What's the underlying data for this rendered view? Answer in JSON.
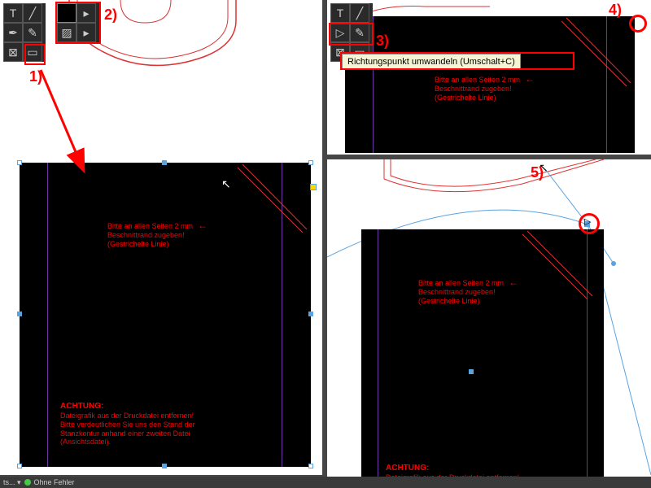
{
  "labels": {
    "l1": "1)",
    "l2": "2)",
    "l3": "3)",
    "l4": "4)",
    "l5": "5)"
  },
  "tooltip": {
    "text": "Richtungspunkt umwandeln (Umschalt+C)"
  },
  "hint": {
    "line1": "Bitte an allen Seiten 2 mm",
    "line2": "Beschnittrand zugeben!",
    "line3": "(Gestrichelte Linie)"
  },
  "warning": {
    "title": "ACHTUNG:",
    "line1": "Dateigrafik aus der Druckdatei entfernen!",
    "line2": "Bitte verdeutlichen Sie uns den Stand der",
    "line3": "Stanzkontur anhand einer zweiten Datei",
    "line4": "(Ansichtsdatei)."
  },
  "status": {
    "menu": "ts... ▾",
    "state": "Ohne Fehler"
  }
}
